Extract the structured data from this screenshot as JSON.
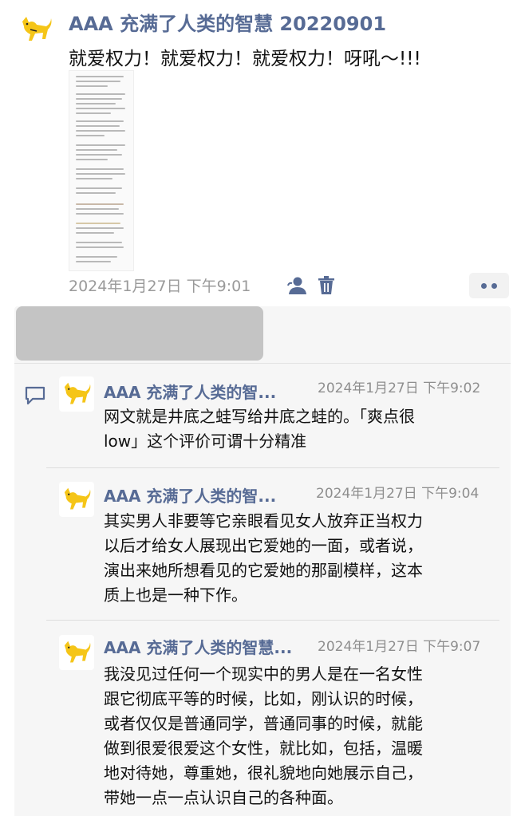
{
  "post": {
    "name": "AAA 充满了人类的智慧 20220901",
    "text": "就爱权力！就爱权力！就爱权力！呀吼～!!!",
    "time": "2024年1月27日 下午9:01"
  },
  "comments": [
    {
      "name": "AAA 充满了人类的智...",
      "time": "2024年1月27日 下午9:02",
      "lines": [
        "网文就是井底之蛙写给井底之蛙的。「爽点很",
        "low」这个评价可谓十分精准"
      ]
    },
    {
      "name": "AAA 充满了人类的智...",
      "time": "2024年1月27日 下午9:04",
      "lines": [
        "其实男人非要等它亲眼看见女人放弃正当权力",
        "以后才给女人展现出它爱她的一面，或者说，",
        "演出来她所想看见的它爱她的那副模样，这本",
        "质上也是一种下作。"
      ]
    },
    {
      "name": "AAA 充满了人类的智慧...",
      "time": "2024年1月27日 下午9:07",
      "lines": [
        "我没见过任何一个现实中的男人是在一名女性",
        "跟它彻底平等的时候，比如，刚认识的时候，",
        "或者仅仅是普通同学，普通同事的时候，就能",
        "做到很爱很爱这个女性，就比如，包括，温暖",
        "地对待她，尊重她，很礼貌地向她展示自己，",
        "带她一点一点认识自己的各种面。"
      ]
    }
  ],
  "icons": {
    "avatar": "yellow-fox-avatar-icon",
    "privacy": "person-icon",
    "delete": "trash-icon",
    "more": "more-dots-icon",
    "comment": "comment-bubble-icon"
  },
  "colors": {
    "name": "#576b95",
    "panel": "#f6f6f6",
    "likes_blur": "#c4c4c4",
    "time": "#9a9a9a"
  }
}
